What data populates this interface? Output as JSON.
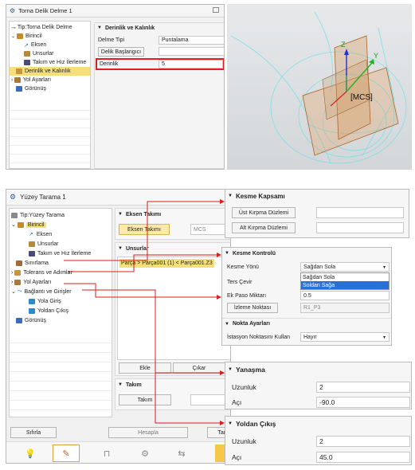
{
  "top_dialog": {
    "title": "Torna Delik Delme 1",
    "tree": [
      "Tip:Torna Delik Delme",
      "Birincil",
      "Eksen",
      "Unsurlar",
      "Takım ve Hız İlerleme",
      "Derinlik ve Kalınlık",
      "Yol Ayarları",
      "Görünüş"
    ],
    "section_title": "Derinlik ve Kalınlık",
    "delme_tipi_label": "Delme Tipi",
    "delme_tipi_value": "Puntalama",
    "delik_baslangici_label": "Delik Başlangıcı",
    "derinlik_label": "Derinlik",
    "derinlik_value": "5"
  },
  "viewport": {
    "axis_z": "Z",
    "axis_y": "Y",
    "mcs_label": "[MCS]"
  },
  "bottom_dialog": {
    "title": "Yüzey Tarama 1",
    "tree": [
      "Tip:Yüzey Tarama",
      "Birincil",
      "Eksen",
      "Unsurlar",
      "Takım ve Hız İlerleme",
      "Sınırlama",
      "Tolerans ve Adımlar",
      "Yol Ayarları",
      "Bağlantı ve Girişler",
      "Yola Giriş",
      "Yoldan Çıkış",
      "Görünüş"
    ],
    "eksen_takimi_title": "Eksen Takımı",
    "eksen_takimi_button": "Eksen Takımı",
    "eksen_takimi_value": "MCS",
    "unsurlar_title": "Unsurlar",
    "unsurlar_item": "Parça > Parça001 (1) < Parça001.Z3",
    "ekle": "Ekle",
    "cikar": "Çıkar",
    "takim_title": "Takım",
    "takim_button": "Takım",
    "sifirla": "Sıfırla",
    "hesapla": "Hesapla",
    "tamam": "Tam"
  },
  "kesme_kapsami": {
    "title": "Kesme Kapsamı",
    "ust": "Üst Kırpma Düzlemi",
    "alt": "Alt Kırpma Düzlemi"
  },
  "kesme_kontrolu": {
    "title": "Kesme Kontrolü",
    "kesme_yonu_label": "Kesme Yönü",
    "kesme_yonu_value": "Sağdan Sola",
    "options": [
      "Sağdan Sola",
      "Soldan Sağa"
    ],
    "ters_cevir": "Ters Çevir",
    "ek_paso_label": "Ek Paso Miktarı",
    "ek_paso_value": "0.5",
    "izleme_noktasi": "İzleme Noktası",
    "izleme_value": "R1_P3",
    "nokta_title": "Nokta Ayarları",
    "istasyon_label": "İstasyon Noktasını Kullan",
    "istasyon_value": "Hayır"
  },
  "yanasma": {
    "title": "Yanaşma",
    "uzunluk_label": "Uzunluk",
    "uzunluk_value": "2",
    "aci_label": "Açı",
    "aci_value": "-90.0"
  },
  "yoldan_cikis": {
    "title": "Yoldan Çıkış",
    "uzunluk_label": "Uzunluk",
    "uzunluk_value": "2",
    "aci_label": "Açı",
    "aci_value": "45.0"
  },
  "colors": {
    "highlight_red": "#e02020",
    "arrow_red": "#d81e1e",
    "selected_bg": "#f5df7a",
    "dropdown_sel": "#2a6fd6"
  }
}
